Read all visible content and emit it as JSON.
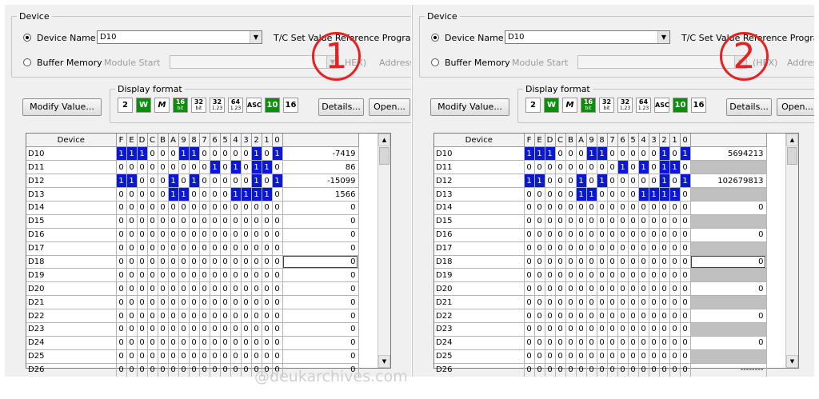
{
  "panels": [
    {
      "badge": "1",
      "device_group": "Device",
      "device_name_label": "Device Name",
      "device_name_value": "D10",
      "tc_label": "T/C Set Value Reference Program",
      "buffer_memory_label": "Buffer Memory",
      "module_start_label": "Module Start",
      "hex_label": "HEX)",
      "address_label": "Address",
      "display_format_group": "Display format",
      "modify_button": "Modify Value...",
      "format_buttons": [
        "2",
        "W",
        "M",
        "16 bit",
        "32 bit",
        "32 1.23",
        "64 1.23",
        "ASC",
        "10",
        "16"
      ],
      "selected_format": "16 bit",
      "details_button": "Details...",
      "open_button": "Open...",
      "table_headers": [
        "Device",
        "F",
        "E",
        "D",
        "C",
        "B",
        "A",
        "9",
        "8",
        "7",
        "6",
        "5",
        "4",
        "3",
        "2",
        "1",
        "0"
      ],
      "rows": [
        {
          "device": "D10",
          "bits": "1110001100000101",
          "value": "-7419"
        },
        {
          "device": "D11",
          "bits": "0000000001010110",
          "value": "86"
        },
        {
          "device": "D12",
          "bits": "1100010100000101",
          "value": "-15099"
        },
        {
          "device": "D13",
          "bits": "0000011000011110",
          "value": "1566"
        },
        {
          "device": "D14",
          "bits": "0000000000000000",
          "value": "0"
        },
        {
          "device": "D15",
          "bits": "0000000000000000",
          "value": "0"
        },
        {
          "device": "D16",
          "bits": "0000000000000000",
          "value": "0"
        },
        {
          "device": "D17",
          "bits": "0000000000000000",
          "value": "0"
        },
        {
          "device": "D18",
          "bits": "0000000000000000",
          "value": "0"
        },
        {
          "device": "D19",
          "bits": "0000000000000000",
          "value": "0"
        },
        {
          "device": "D20",
          "bits": "0000000000000000",
          "value": "0"
        },
        {
          "device": "D21",
          "bits": "0000000000000000",
          "value": "0"
        },
        {
          "device": "D22",
          "bits": "0000000000000000",
          "value": "0"
        },
        {
          "device": "D23",
          "bits": "0000000000000000",
          "value": "0"
        },
        {
          "device": "D24",
          "bits": "0000000000000000",
          "value": "0"
        },
        {
          "device": "D25",
          "bits": "0000000000000000",
          "value": "0"
        },
        {
          "device": "D26",
          "bits": "0000000000000000",
          "value": "0"
        }
      ],
      "current_row": 8
    },
    {
      "badge": "2",
      "device_group": "Device",
      "device_name_label": "Device Name",
      "device_name_value": "D10",
      "tc_label": "T/C Set Value Reference Program",
      "buffer_memory_label": "Buffer Memory",
      "module_start_label": "Module Start",
      "hex_label": "(HEX)",
      "address_label": "Address",
      "display_format_group": "Display format",
      "modify_button": "Modify Value...",
      "format_buttons": [
        "2",
        "W",
        "M",
        "16 bit",
        "32 bit",
        "32 1.23",
        "64 1.23",
        "ASC",
        "10",
        "16"
      ],
      "selected_format": "32 bit",
      "details_button": "Details...",
      "open_button": "Open...",
      "table_headers": [
        "Device",
        "F",
        "E",
        "D",
        "C",
        "B",
        "A",
        "9",
        "8",
        "7",
        "6",
        "5",
        "4",
        "3",
        "2",
        "1",
        "0"
      ],
      "rows": [
        {
          "device": "D10",
          "bits": "1110001100000101",
          "value": "5694213"
        },
        {
          "device": "D11",
          "bits": "0000000001010110",
          "value": ""
        },
        {
          "device": "D12",
          "bits": "1100010100000101",
          "value": "102679813"
        },
        {
          "device": "D13",
          "bits": "0000011000011110",
          "value": ""
        },
        {
          "device": "D14",
          "bits": "0000000000000000",
          "value": "0"
        },
        {
          "device": "D15",
          "bits": "0000000000000000",
          "value": ""
        },
        {
          "device": "D16",
          "bits": "0000000000000000",
          "value": "0"
        },
        {
          "device": "D17",
          "bits": "0000000000000000",
          "value": ""
        },
        {
          "device": "D18",
          "bits": "0000000000000000",
          "value": "0"
        },
        {
          "device": "D19",
          "bits": "0000000000000000",
          "value": ""
        },
        {
          "device": "D20",
          "bits": "0000000000000000",
          "value": "0"
        },
        {
          "device": "D21",
          "bits": "0000000000000000",
          "value": ""
        },
        {
          "device": "D22",
          "bits": "0000000000000000",
          "value": "0"
        },
        {
          "device": "D23",
          "bits": "0000000000000000",
          "value": ""
        },
        {
          "device": "D24",
          "bits": "0000000000000000",
          "value": "0"
        },
        {
          "device": "D25",
          "bits": "0000000000000000",
          "value": ""
        },
        {
          "device": "D26",
          "bits": "0000000000000000",
          "value": "--------"
        }
      ],
      "current_row": 8
    }
  ],
  "watermark": "@deukarchives.com",
  "colors": {
    "bit_on": "#0a17d4",
    "format_green": "#0a8f0a",
    "badge_red": "#e52222",
    "value_gray": "#c0c0c0"
  }
}
